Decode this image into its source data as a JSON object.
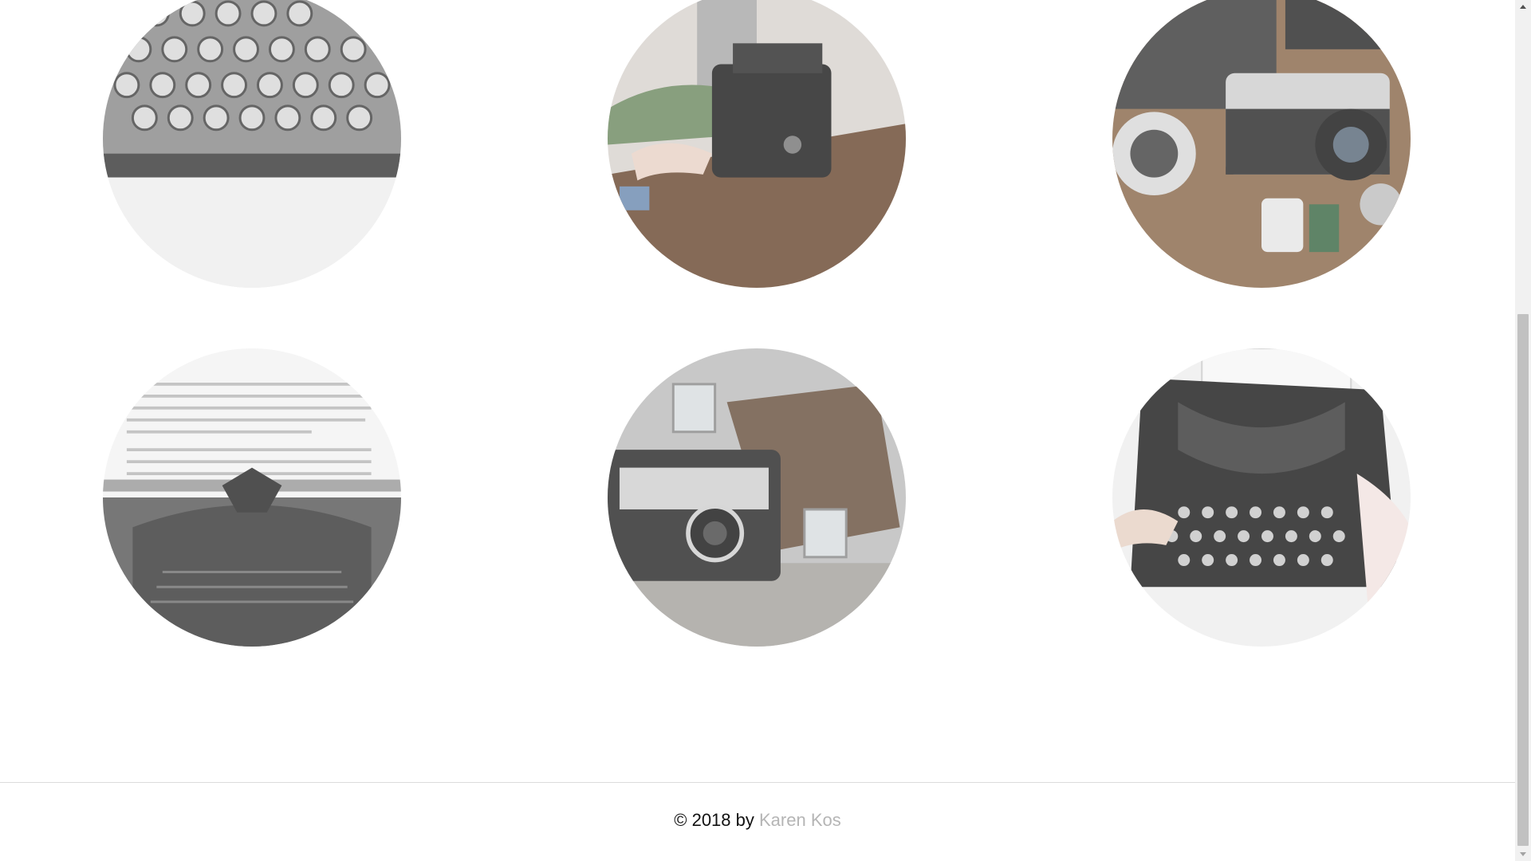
{
  "gallery": {
    "photos": [
      {
        "name": "typewriter-keys-closeup-photo",
        "subject": "typewriter keys closeup"
      },
      {
        "name": "typing-on-vintage-typewriter-photo",
        "subject": "hands typing on vintage typewriter"
      },
      {
        "name": "nikon-camera-and-film-photo",
        "subject": "Nikon camera with lenses and film"
      },
      {
        "name": "typewriter-with-paper-photo",
        "subject": "typewriter with typed paper"
      },
      {
        "name": "kodak-instamatic-camera-photo",
        "subject": "Kodak Instamatic camera with flash cube"
      },
      {
        "name": "black-typewriter-hands-photo",
        "subject": "hands on black typewriter"
      }
    ]
  },
  "footer": {
    "prefix": "© 2018 by ",
    "author": "Karen Kos",
    "author_color": "#b5b5b5"
  }
}
